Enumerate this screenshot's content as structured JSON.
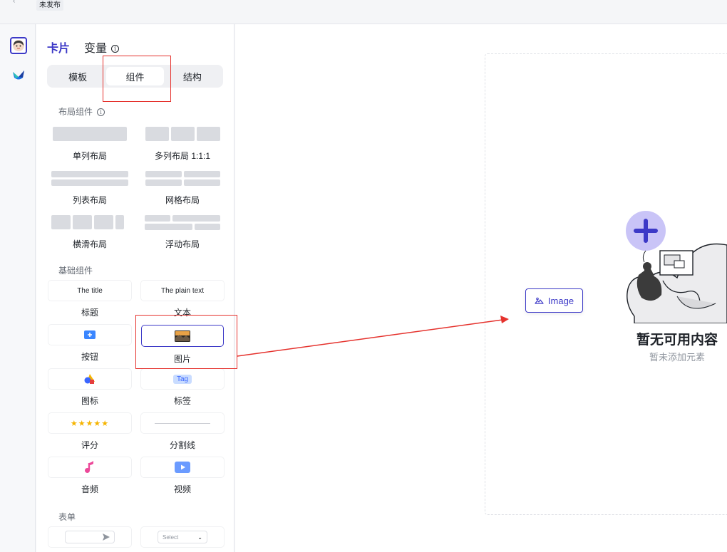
{
  "topbar": {
    "status": "未发布"
  },
  "panel": {
    "tabs": {
      "card": "卡片",
      "variables": "变量"
    },
    "segments": [
      "模板",
      "组件",
      "结构"
    ],
    "layout_section": {
      "title": "布局组件"
    },
    "layout_items": [
      "单列布局",
      "多列布局 1:1:1",
      "列表布局",
      "网格布局",
      "横滑布局",
      "浮动布局"
    ],
    "basic_section": {
      "title": "基础组件"
    },
    "basic_items": {
      "title_preview": "The title",
      "title_label": "标题",
      "text_preview": "The plain text",
      "text_label": "文本",
      "button_label": "按钮",
      "image_label": "图片",
      "icon_label": "图标",
      "tag_preview": "Tag",
      "tag_label": "标签",
      "rating_label": "评分",
      "divider_label": "分割线",
      "audio_label": "音频",
      "video_label": "视频"
    },
    "form_section": {
      "title": "表单"
    },
    "form_items": {
      "select_preview": "Select"
    }
  },
  "canvas": {
    "drag_chip_label": "Image",
    "empty_title": "暂无可用内容",
    "empty_subtitle": "暂未添加元素"
  },
  "colors": {
    "accent": "#3c39c7",
    "highlight": "#e5322d",
    "star": "#f5b400"
  }
}
